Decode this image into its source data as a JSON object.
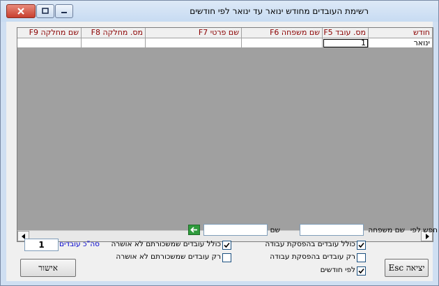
{
  "window": {
    "title": "רשימת העובדים מחודש ינואר עד ינואר לפי חודשים"
  },
  "grid": {
    "columns": [
      {
        "key": "month",
        "label": "חודש"
      },
      {
        "key": "f5",
        "label": "מס. עובד F5"
      },
      {
        "key": "f6",
        "label": "שם משפחה F6"
      },
      {
        "key": "f7",
        "label": "שם פרטי F7"
      },
      {
        "key": "f8",
        "label": "מס. מחלקה F8"
      },
      {
        "key": "f9",
        "label": "שם מחלקה F9"
      }
    ],
    "rows": [
      {
        "month": "ינואר",
        "f5": "1",
        "f6": "",
        "f7": "",
        "f8": "",
        "f9": ""
      }
    ]
  },
  "search": {
    "label": "חפש לפי",
    "last_name_label": "שם משפחה",
    "last_name_value": "",
    "first_name_label": "שם פרטי",
    "first_name_value": ""
  },
  "options": {
    "include_suspended": {
      "label": "כולל עובדים בהפסקת עבודה",
      "checked": true
    },
    "only_suspended": {
      "label": "רק עובדים בהפסקת עבודה",
      "checked": false
    },
    "by_months": {
      "label": "לפי חודשים",
      "checked": true
    },
    "include_unapproved_salary": {
      "label": "כולל עובדים שמשכורתם לא אושרה",
      "checked": true
    },
    "only_unapproved_salary": {
      "label": "רק עובדים שמשכורתם לא אושרה",
      "checked": false
    }
  },
  "totals": {
    "label": "סה\"כ עובדים:",
    "value": "1"
  },
  "buttons": {
    "exit": "יציאה Esc",
    "approve": "אישור"
  },
  "colors": {
    "header_text": "#8b0000",
    "totals_label": "#0000cc",
    "grid_empty": "#a0a0a0"
  }
}
